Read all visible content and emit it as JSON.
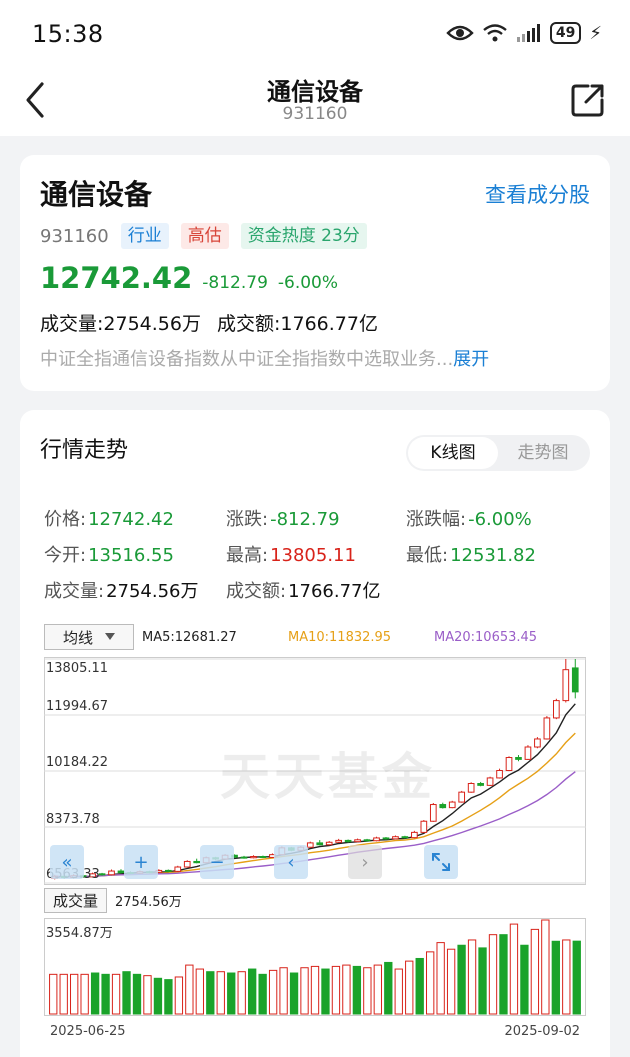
{
  "status": {
    "time": "15:38",
    "battery": "49"
  },
  "header": {
    "title": "通信设备",
    "subtitle": "931160"
  },
  "info": {
    "name": "通信设备",
    "view_holdings": "查看成分股",
    "code": "931160",
    "tags": [
      "行业",
      "高估",
      "资金热度 23分"
    ],
    "price": "12742.42",
    "change": "-812.79",
    "change_pct": "-6.00%",
    "volume": "成交量:2754.56万",
    "amount": "成交额:1766.77亿",
    "description": "中证全指通信设备指数从中证全指指数中选取业务...",
    "expand": "展开"
  },
  "market": {
    "title": "行情走势",
    "toggle": [
      "K线图",
      "走势图"
    ],
    "stats": {
      "price_label": "价格:",
      "price": "12742.42",
      "change_label": "涨跌:",
      "change": "-812.79",
      "pct_label": "涨跌幅:",
      "pct": "-6.00%",
      "open_label": "今开:",
      "open": "13516.55",
      "high_label": "最高:",
      "high": "13805.11",
      "low_label": "最低:",
      "low": "12531.82",
      "vol_label": "成交量:",
      "vol": "2754.56万",
      "amt_label": "成交额:",
      "amt": "1766.77亿"
    },
    "ma_select": "均线",
    "ma5": "MA5:12681.27",
    "ma10": "MA10:11832.95",
    "ma20": "MA20:10653.45",
    "y_ticks": [
      "13805.11",
      "11994.67",
      "10184.22",
      "8373.78",
      "6563.33"
    ],
    "watermark": "天天基金",
    "volume_label": "成交量",
    "volume_value": "2754.56万",
    "volume_max": "3554.87万",
    "date_start": "2025-06-25",
    "date_end": "2025-09-02"
  },
  "chart_data": {
    "type": "candlestick",
    "ylim": [
      6563.33,
      13805.11
    ],
    "y_ticks": [
      13805.11,
      11994.67,
      10184.22,
      8373.78,
      6563.33
    ],
    "x_range": [
      "2025-06-25",
      "2025-09-02"
    ],
    "candles": [
      {
        "o": 6720,
        "c": 6780,
        "h": 6830,
        "l": 6680
      },
      {
        "o": 6780,
        "c": 6740,
        "h": 6810,
        "l": 6700
      },
      {
        "o": 6740,
        "c": 6800,
        "h": 6850,
        "l": 6710
      },
      {
        "o": 6800,
        "c": 6760,
        "h": 6830,
        "l": 6730
      },
      {
        "o": 6760,
        "c": 6860,
        "h": 6900,
        "l": 6740
      },
      {
        "o": 6860,
        "c": 6830,
        "h": 6890,
        "l": 6800
      },
      {
        "o": 6830,
        "c": 6950,
        "h": 7000,
        "l": 6810
      },
      {
        "o": 6950,
        "c": 6900,
        "h": 7010,
        "l": 6870
      },
      {
        "o": 6900,
        "c": 6880,
        "h": 6940,
        "l": 6850
      },
      {
        "o": 6880,
        "c": 6930,
        "h": 6970,
        "l": 6860
      },
      {
        "o": 6930,
        "c": 6910,
        "h": 6960,
        "l": 6880
      },
      {
        "o": 6910,
        "c": 6970,
        "h": 7010,
        "l": 6890
      },
      {
        "o": 6970,
        "c": 6940,
        "h": 7000,
        "l": 6910
      },
      {
        "o": 6940,
        "c": 7080,
        "h": 7120,
        "l": 6920
      },
      {
        "o": 7080,
        "c": 7260,
        "h": 7300,
        "l": 7060
      },
      {
        "o": 7260,
        "c": 7220,
        "h": 7350,
        "l": 7200
      },
      {
        "o": 7220,
        "c": 7380,
        "h": 7420,
        "l": 7200
      },
      {
        "o": 7380,
        "c": 7340,
        "h": 7410,
        "l": 7300
      },
      {
        "o": 7340,
        "c": 7460,
        "h": 7500,
        "l": 7320
      },
      {
        "o": 7460,
        "c": 7400,
        "h": 7490,
        "l": 7370
      },
      {
        "o": 7400,
        "c": 7380,
        "h": 7440,
        "l": 7350
      },
      {
        "o": 7380,
        "c": 7420,
        "h": 7460,
        "l": 7360
      },
      {
        "o": 7420,
        "c": 7390,
        "h": 7450,
        "l": 7370
      },
      {
        "o": 7390,
        "c": 7480,
        "h": 7520,
        "l": 7370
      },
      {
        "o": 7480,
        "c": 7700,
        "h": 7750,
        "l": 7460
      },
      {
        "o": 7700,
        "c": 7620,
        "h": 7730,
        "l": 7590
      },
      {
        "o": 7620,
        "c": 7720,
        "h": 7760,
        "l": 7600
      },
      {
        "o": 7720,
        "c": 7860,
        "h": 7900,
        "l": 7700
      },
      {
        "o": 7860,
        "c": 7800,
        "h": 7950,
        "l": 7780
      },
      {
        "o": 7800,
        "c": 7880,
        "h": 7920,
        "l": 7780
      },
      {
        "o": 7880,
        "c": 7940,
        "h": 7990,
        "l": 7860
      },
      {
        "o": 7940,
        "c": 7900,
        "h": 7970,
        "l": 7870
      },
      {
        "o": 7900,
        "c": 7960,
        "h": 8000,
        "l": 7880
      },
      {
        "o": 7960,
        "c": 7930,
        "h": 7990,
        "l": 7900
      },
      {
        "o": 7930,
        "c": 8020,
        "h": 8060,
        "l": 7910
      },
      {
        "o": 8020,
        "c": 7990,
        "h": 8050,
        "l": 7960
      },
      {
        "o": 7990,
        "c": 8060,
        "h": 8100,
        "l": 7970
      },
      {
        "o": 8060,
        "c": 8030,
        "h": 8090,
        "l": 8000
      },
      {
        "o": 8030,
        "c": 8200,
        "h": 8250,
        "l": 8010
      },
      {
        "o": 8200,
        "c": 8560,
        "h": 8600,
        "l": 8180
      },
      {
        "o": 8560,
        "c": 9100,
        "h": 9150,
        "l": 8540
      },
      {
        "o": 9100,
        "c": 9000,
        "h": 9160,
        "l": 8970
      },
      {
        "o": 9000,
        "c": 9180,
        "h": 9220,
        "l": 8980
      },
      {
        "o": 9180,
        "c": 9500,
        "h": 9540,
        "l": 9160
      },
      {
        "o": 9500,
        "c": 9780,
        "h": 9820,
        "l": 9480
      },
      {
        "o": 9780,
        "c": 9720,
        "h": 9830,
        "l": 9690
      },
      {
        "o": 9720,
        "c": 9960,
        "h": 10000,
        "l": 9700
      },
      {
        "o": 9960,
        "c": 10200,
        "h": 10260,
        "l": 9940
      },
      {
        "o": 10200,
        "c": 10620,
        "h": 10660,
        "l": 10180
      },
      {
        "o": 10620,
        "c": 10560,
        "h": 10700,
        "l": 10500
      },
      {
        "o": 10560,
        "c": 10960,
        "h": 11020,
        "l": 10540
      },
      {
        "o": 10960,
        "c": 11220,
        "h": 11280,
        "l": 10920
      },
      {
        "o": 11220,
        "c": 11900,
        "h": 11960,
        "l": 11200
      },
      {
        "o": 11900,
        "c": 12460,
        "h": 12520,
        "l": 11860
      },
      {
        "o": 12460,
        "c": 13460,
        "h": 13805.11,
        "l": 12400
      },
      {
        "o": 13516.55,
        "c": 12742.42,
        "h": 13805.11,
        "l": 12531.82
      }
    ],
    "ma_series": [
      {
        "name": "MA5",
        "latest": 12681.27
      },
      {
        "name": "MA10",
        "latest": 11832.95
      },
      {
        "name": "MA20",
        "latest": 10653.45
      }
    ],
    "volume": {
      "max": 3554.87,
      "unit": "万",
      "latest": 2754.56,
      "bars": [
        {
          "v": 1500,
          "up": true
        },
        {
          "v": 1500,
          "up": true
        },
        {
          "v": 1500,
          "up": true
        },
        {
          "v": 1500,
          "up": true
        },
        {
          "v": 1550,
          "up": false
        },
        {
          "v": 1500,
          "up": false
        },
        {
          "v": 1500,
          "up": true
        },
        {
          "v": 1600,
          "up": false
        },
        {
          "v": 1500,
          "up": false
        },
        {
          "v": 1450,
          "up": true
        },
        {
          "v": 1350,
          "up": false
        },
        {
          "v": 1300,
          "up": false
        },
        {
          "v": 1400,
          "up": true
        },
        {
          "v": 1850,
          "up": true
        },
        {
          "v": 1700,
          "up": true
        },
        {
          "v": 1600,
          "up": false
        },
        {
          "v": 1600,
          "up": true
        },
        {
          "v": 1550,
          "up": false
        },
        {
          "v": 1600,
          "up": true
        },
        {
          "v": 1700,
          "up": false
        },
        {
          "v": 1500,
          "up": false
        },
        {
          "v": 1650,
          "up": true
        },
        {
          "v": 1750,
          "up": true
        },
        {
          "v": 1550,
          "up": false
        },
        {
          "v": 1750,
          "up": true
        },
        {
          "v": 1800,
          "up": true
        },
        {
          "v": 1700,
          "up": false
        },
        {
          "v": 1800,
          "up": true
        },
        {
          "v": 1850,
          "up": true
        },
        {
          "v": 1800,
          "up": false
        },
        {
          "v": 1750,
          "up": true
        },
        {
          "v": 1850,
          "up": true
        },
        {
          "v": 1950,
          "up": false
        },
        {
          "v": 1700,
          "up": true
        },
        {
          "v": 2000,
          "up": true
        },
        {
          "v": 2100,
          "up": false
        },
        {
          "v": 2350,
          "up": true
        },
        {
          "v": 2700,
          "up": true
        },
        {
          "v": 2450,
          "up": true
        },
        {
          "v": 2600,
          "up": false
        },
        {
          "v": 2800,
          "up": true
        },
        {
          "v": 2500,
          "up": false
        },
        {
          "v": 3000,
          "up": true
        },
        {
          "v": 3000,
          "up": false
        },
        {
          "v": 3400,
          "up": true
        },
        {
          "v": 2600,
          "up": false
        },
        {
          "v": 3200,
          "up": true
        },
        {
          "v": 3554.87,
          "up": true
        },
        {
          "v": 2750,
          "up": false
        },
        {
          "v": 2800,
          "up": true
        },
        {
          "v": 2754.56,
          "up": false
        }
      ]
    }
  }
}
